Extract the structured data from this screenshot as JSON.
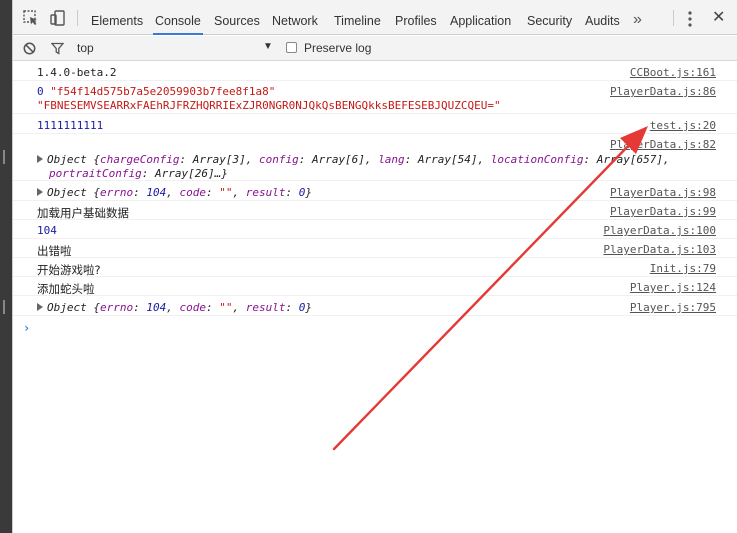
{
  "toolbar": {
    "tabs": [
      {
        "label": "Elements",
        "active": false
      },
      {
        "label": "Console",
        "active": true
      },
      {
        "label": "Sources",
        "active": false
      },
      {
        "label": "Network",
        "active": false
      },
      {
        "label": "Timeline",
        "active": false
      },
      {
        "label": "Profiles",
        "active": false
      },
      {
        "label": "Application",
        "active": false
      },
      {
        "label": "Security",
        "active": false
      },
      {
        "label": "Audits",
        "active": false
      }
    ],
    "more_label": "»",
    "close_label": "✕"
  },
  "filter": {
    "context": "top",
    "preserve_log_label": "Preserve log",
    "preserve_log_checked": false
  },
  "console": {
    "messages": [
      {
        "text": "1.4.0-beta.2",
        "source": "CCBoot.js:161"
      },
      {
        "prefix": "0",
        "line1": "\"f54f14d575b7a5e2059903b7fee8f1a8\"",
        "line2": "\"FBNESEMVSEARRxFAEhRJFRZHQRRIExZJR0NGR0NJQkQsBENGQkksBEFESEBJQUZCQEU=\"",
        "source": "PlayerData.js:86"
      },
      {
        "text": "1111111111",
        "source": "test.js:20"
      },
      {
        "source": "PlayerData.js:82",
        "object_line1": "Object {chargeConfig: Array[3], config: Array[6], lang: Array[54], locationConfig: Array[657],",
        "object_line2": "portraitConfig: Array[26]…}",
        "parts_line1": [
          {
            "k": "Object {",
            "c": "obj"
          },
          {
            "k": "chargeConfig",
            "c": "prop"
          },
          {
            "k": ": Array[3], ",
            "c": "obj"
          },
          {
            "k": "config",
            "c": "prop"
          },
          {
            "k": ": Array[6], ",
            "c": "obj"
          },
          {
            "k": "lang",
            "c": "prop"
          },
          {
            "k": ": Array[54], ",
            "c": "obj"
          },
          {
            "k": "locationConfig",
            "c": "prop"
          },
          {
            "k": ": Array[657],",
            "c": "obj"
          }
        ]
      },
      {
        "object": {
          "prefix": "Object {",
          "errno_key": "errno",
          "errno_val": "104",
          "code_key": "code",
          "code_val": "\"\"",
          "result_key": "result",
          "result_val": "0",
          "suffix": "}"
        },
        "source": "PlayerData.js:98"
      },
      {
        "text": "加载用户基础数据",
        "source": "PlayerData.js:99"
      },
      {
        "text": "104",
        "source": "PlayerData.js:100"
      },
      {
        "text": "出错啦",
        "source": "PlayerData.js:103"
      },
      {
        "text": "开始游戏啦?",
        "source": "Init.js:79"
      },
      {
        "text": "添加蛇头啦",
        "source": "Player.js:124"
      },
      {
        "object": {
          "prefix": "Object {",
          "errno_key": "errno",
          "errno_val": "104",
          "code_key": "code",
          "code_val": "\"\"",
          "result_key": "result",
          "result_val": "0",
          "suffix": "}"
        },
        "source": "Player.js:795"
      }
    ],
    "prompt": "›"
  },
  "annotation": {
    "color": "#e53935"
  }
}
